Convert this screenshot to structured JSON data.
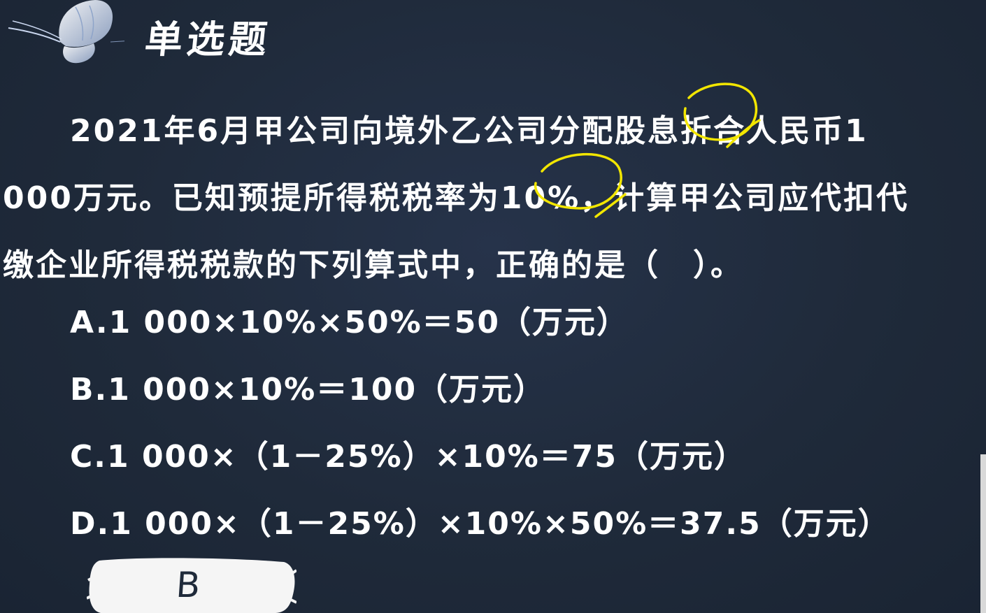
{
  "header": {
    "title": "单选题",
    "logo": "butterfly-icon"
  },
  "question": {
    "lines": [
      "2021年6月甲公司向境外乙公司分配股息折合人民币1",
      "000万元。已知预提所得税税率为10%，计算甲公司应代扣代",
      "缴企业所得税税款的下列算式中，正确的是（　）。"
    ]
  },
  "options": [
    "A.1 000×10%×50%＝50（万元）",
    "B.1 000×10%＝100（万元）",
    "C.1 000×（1－25%）×10%＝75（万元）",
    "D.1 000×（1－25%）×10%×50%＝37.5（万元）"
  ],
  "answer": {
    "letter": "B"
  },
  "colors": {
    "background": "#1f2a3a",
    "text": "#ffffff",
    "highlight": "#f2e600",
    "answer_card": "#f5f5f5"
  }
}
